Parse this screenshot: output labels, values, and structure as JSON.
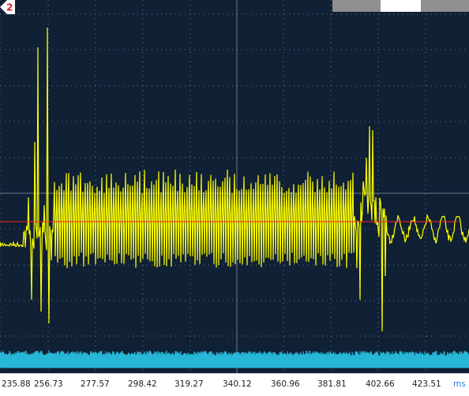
{
  "window": {
    "channel_marker": "2"
  },
  "colors": {
    "background": "#102035",
    "grid": "#6b7a8c",
    "signal": "#ffff00",
    "reference_line": "#ff2020",
    "digital": "#27b6d6",
    "unit_text": "#2b7bd9"
  },
  "status_bar": {
    "segments": [
      {
        "name": "seg-left",
        "color": "#8f8f8f"
      },
      {
        "name": "seg-middle",
        "color": "#ffffff"
      },
      {
        "name": "seg-right",
        "color": "#8f8f8f"
      }
    ]
  },
  "time_axis": {
    "ticks": [
      "235.88",
      "256.73",
      "277.57",
      "298.42",
      "319.27",
      "340.12",
      "360.96",
      "381.81",
      "402.66",
      "423.51"
    ],
    "unit": "ms"
  }
}
